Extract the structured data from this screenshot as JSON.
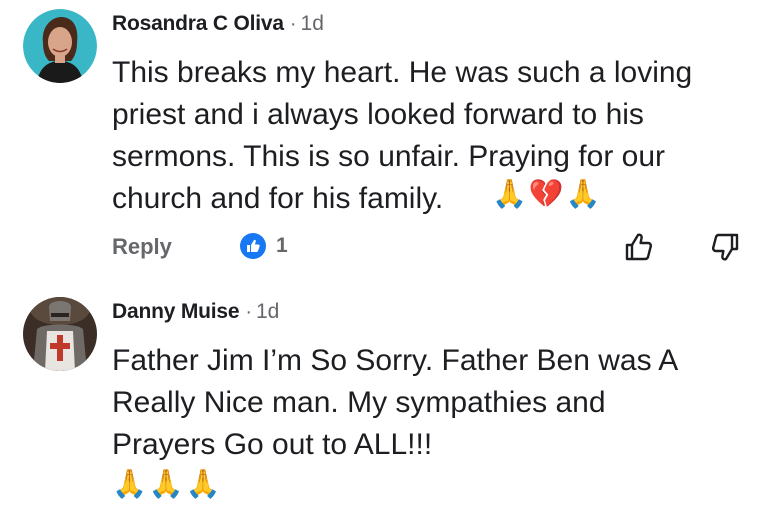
{
  "comments": [
    {
      "author": "Rosandra C Oliva",
      "separator": "·",
      "time": "1d",
      "text": "This breaks my heart.  He was such a loving\npriest and i always looked forward to his\nsermons.  This is so unfair.   Praying for our\nchurch and for his family.",
      "emoji": "🙏💔🙏",
      "reply_label": "Reply",
      "like_count": "1",
      "avatar_colors": {
        "bg": "#3ab7c6",
        "skin": "#d9a58a",
        "hair": "#4a2a1a",
        "shirt": "#1a1a1a"
      }
    },
    {
      "author": "Danny Muise",
      "separator": "·",
      "time": "1d",
      "text": "Father Jim I’m So Sorry. Father Ben was A\nReally Nice man. My sympathies and\nPrayers Go out to ALL!!!",
      "emoji": "🙏🙏🙏",
      "avatar_colors": {
        "bg": "#3a2e26",
        "armor": "#6f6a66",
        "cross": "#c0392b",
        "tabard": "#e8e4df"
      }
    }
  ],
  "colors": {
    "like_blue": "#1877f2",
    "secondary_text": "#65676b",
    "primary_text": "#1c1e21"
  },
  "icons": {
    "like_badge": "thumbs-up-icon",
    "upvote": "thumbs-up-outline-icon",
    "downvote": "thumbs-down-outline-icon"
  }
}
